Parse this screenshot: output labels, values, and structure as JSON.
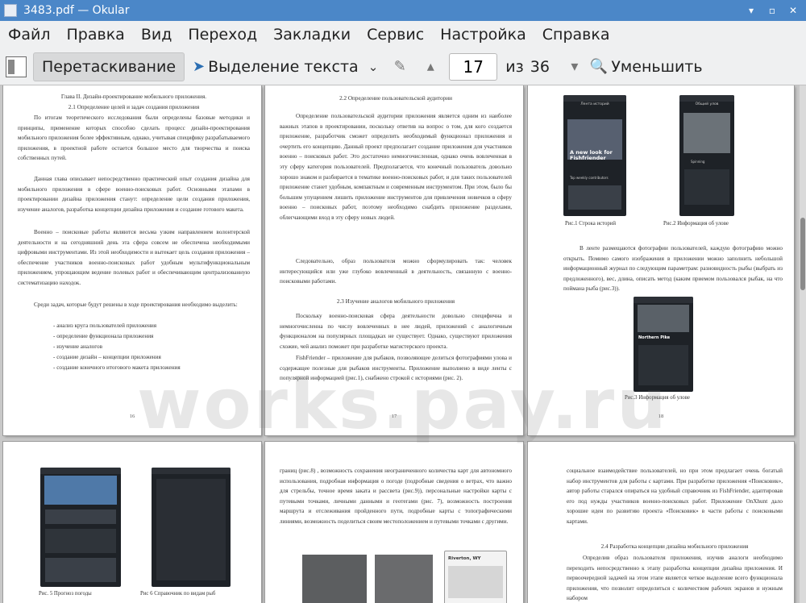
{
  "window": {
    "title": "3483.pdf  — Okular"
  },
  "menu": [
    "Файл",
    "Правка",
    "Вид",
    "Переход",
    "Закладки",
    "Сервис",
    "Настройка",
    "Справка"
  ],
  "toolbar": {
    "drag_label": "Перетаскивание",
    "select_label": "Выделение текста",
    "page_value": "17",
    "of_label": "из",
    "total_pages": "36",
    "zoom_out_label": "Уменьшить"
  },
  "watermark": "works.pay.ru",
  "pages": {
    "p16": {
      "number": "16",
      "heading1": "Глава II. Дизайн-проектирование мобильного приложения.",
      "heading2": "2.1 Определение целей и задач создания приложения",
      "para1": "По итогам теоретического исследования были определены базовые методики и принципы, применение которых способно сделать процесс дизайн-проектирования мобильного приложения более эффективным, однако, учитывая специфику разрабатываемого приложения, в проектной работе остается большое место для творчества и поиска собственных путей.",
      "para2": "Данная глава описывает непосредственно практический опыт создания дизайна для мобильного приложения в сфере военно-поисковых работ. Основными этапами в проектировании дизайна приложения станут: определение цели создания приложения, изучение аналогов, разработка концепции дизайна приложения и создание готового макета.",
      "para3": "Военно – поисковые работы являются весьма узким направлением волонтерской деятельности и на сегодняшний день эта сфера совсем не обеспечена необходимыми цифровыми инструментами. Из этой необходимости и вытекает цель создания приложения – обеспечение участников военно-поисковых работ удобным мультифункциональным приложением, упрощающим ведение полевых работ и обеспечивающим централизованную систематизацию находок.",
      "para4": "Среди задач, которые будут решены в ходе проектирования необходимо выделить:",
      "list": [
        "- анализ круга пользователей приложения",
        "- определение функционала приложения",
        "- изучение аналогов",
        "- создание дизайн – концепции приложения",
        "- создание конечного итогового макета приложения"
      ]
    },
    "p17": {
      "number": "17",
      "heading1": "2.2 Определение пользовательской аудитории",
      "para1": "Определение пользовательской аудитории приложения является одним из наиболее важных этапов в проектировании, поскольку ответив на вопрос о том, для кого создается приложение, разработчик сможет определить необходимый функционал приложения и очертить его концепцию. Данный проект предполагает создание приложения для участников военно – поисковых работ. Это достаточно немногочисленная, однако очень вовлеченная в эту сферу категория пользователей. Предполагается, что конечный пользователь довольно хорошо знаком и разбирается в тематике военно-поисковых работ, и для таких пользователей приложение станет удобным, компактным и современным инструментом. При этом, было бы большим упущением лишить приложение инструментов для привлечения новичков в сферу военно – поисковых работ, поэтому необходимо снабдить приложение разделами, облегчающими вход в эту сферу новых людей.",
      "para2": "Следовательно, образ пользователя можно сформулировать так: человек интересующийся или уже глубоко вовлеченный в деятельность, связанную с военно-поисковыми работами.",
      "heading2": "2.3 Изучение аналогов мобильного приложения",
      "para3": "Поскольку военно-поисковая сфера деятельности довольно специфична и немногочисленна по числу вовлеченных в нее людей, приложений с аналогичным функционалом на популярных площадках не существует. Однако, существуют приложения схожие, чей анализ поможет при разработке магистерского проекта.",
      "para4": "FishFriender – приложение для рыбаков, позволяющее делиться фотографиями улова и содержащее полезные для рыбаков инструменты. Приложение выполнено в виде ленты с популярной информацией (рис.1), снабжено строкой с историями (рис. 2)."
    },
    "p18": {
      "number": "18",
      "phone1_header": "Лента историй",
      "phone1_title": "A new look for Fishfriender",
      "phone1_sub": "Top weekly contributors",
      "phone2_header": "Общий улов",
      "phone2_item": "Spinning",
      "cap1": "Рис.1 Строка историй",
      "cap2": "Рис.2 Информация об улове",
      "para1": "В ленте размещаются фотографии пользователей, каждую фотографию можно открыть. Помимо самого изображения в приложении можно заполнить небольшой информационный журнал по следующим параметрам: разновидность рыбы (выбрать из предложенного), вес, длина, описать метод (каким приемом пользовался рыбак, на что поймана рыба (рис.3)).",
      "phone3_title": "Northern Pike",
      "cap3": "Рис.3 Информация об улове"
    },
    "p19": {
      "cap1": "Рис. 5  Прогноз погоды",
      "cap2": "Рис 6 Справочник по видам рыб"
    },
    "p20": {
      "para1": "границ (рис.8) , возможность сохранения неограниченного количества карт для автономного использования, подробная информация о погоде (подробные сведения о ветрах, что важно для стрельбы, точное время заката и рассвета (рис.9)), персональные настройки карты с путевыми точками, личными данными и геотегами (рис. 7), возможность построения маршрута и отслеживания пройденного пути, подробные карты с топографическими линиями, возможность поделиться своим местоположением и путевыми точками с другими.",
      "phone_label": "Riverton, WY"
    },
    "p21": {
      "para1": "социальное взаимодействие пользователей, но при этом предлагает очень богатый набор инструментов для работы с картами. При разработке приложения «Поисковик», автор работы старался опираться на удобный справочник из FishFriender, адаптировав его под нужды участников военно-поисковых работ. Приложение OnXhunt дало хорошие идеи по развитию проекта «Поисковик» в части работы с поисковыми картами.",
      "heading1": "2.4 Разработка концепции дизайна мобильного приложения",
      "para2": "Определив образ пользователя приложения, изучив аналоги необходимо переходить непосредственно к этапу разработка концепции дизайна приложения. И первоочередной задачей на этом этапе является четкое выделение всего функционала приложения, что позволит определиться с количеством рабочих экранов и нужным набором"
    }
  }
}
